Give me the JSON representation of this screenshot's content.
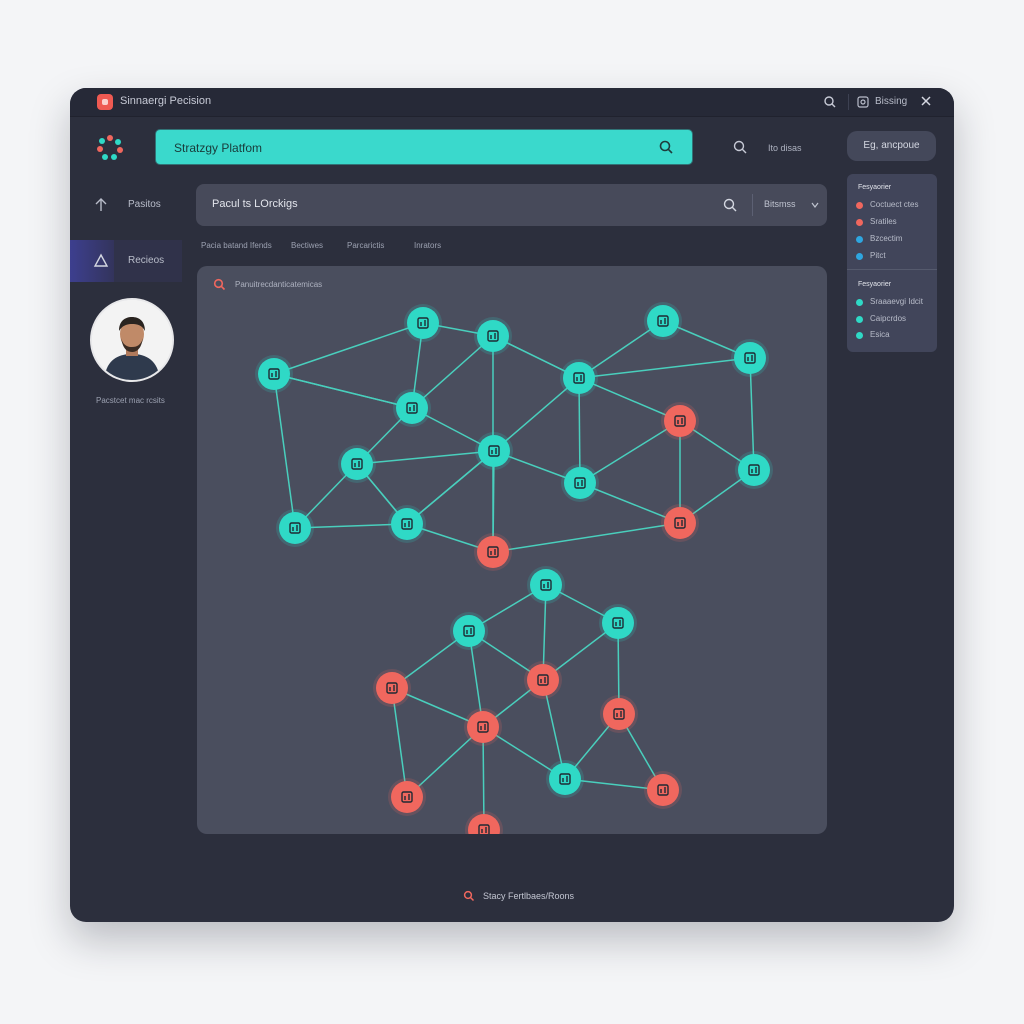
{
  "window": {
    "title": "Sinnaergi Pecision",
    "settings_label": "Bissing"
  },
  "header": {
    "search_value": "Stratzgy Platfom",
    "side_label": "Ito disas",
    "button_label": "Eg, ancpoue"
  },
  "sidebar": {
    "items": [
      {
        "label": "Pasitos",
        "icon": "arrow-up-icon"
      },
      {
        "label": "Recieos",
        "icon": "triangle-icon"
      }
    ],
    "avatar_caption": "Pacstcet mac rcsits"
  },
  "search_bar": {
    "text": "Pacul ts LOrckigs",
    "dropdown_label": "Bitsmss"
  },
  "filter_tabs": [
    "Pacia batand Ifends",
    "Bectiwes",
    "Parcarictis",
    "Inrators"
  ],
  "graph": {
    "header_text": "Panuitrecdanticatemicas",
    "colors": {
      "teal": "#2fd9c6",
      "coral": "#f0675e",
      "edge": "#49cfbd"
    }
  },
  "legend": {
    "group1_title": "Fesyaorier",
    "group1_items": [
      {
        "label": "Coctuect ctes",
        "color": "#f0675e"
      },
      {
        "label": "Sratiles",
        "color": "#f0675e"
      },
      {
        "label": "Bzcectim",
        "color": "#2ea6e0"
      },
      {
        "label": "Pitct",
        "color": "#2ea6e0"
      }
    ],
    "group2_title": "Fesyaorier",
    "group2_items": [
      {
        "label": "Sraaaevgi Idcit",
        "color": "#2fd9c6"
      },
      {
        "label": "Caipcrdos",
        "color": "#2fd9c6"
      },
      {
        "label": "Esica",
        "color": "#2fd9c6"
      }
    ]
  },
  "footer": {
    "text": "Stacy Fertlbaes/Roons"
  }
}
